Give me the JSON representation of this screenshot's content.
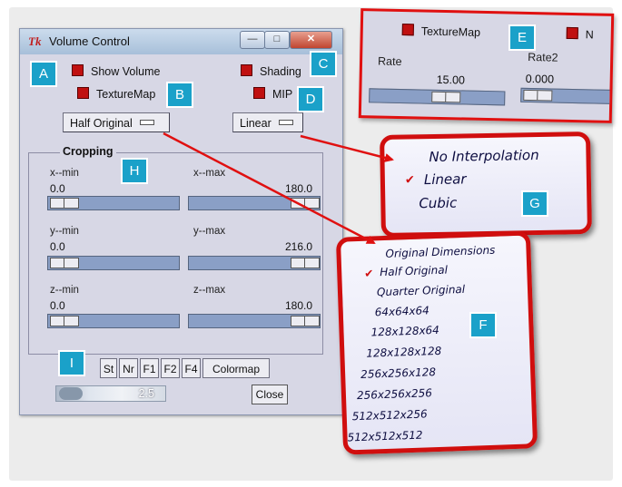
{
  "window": {
    "title": "Volume Control",
    "title_icon": "Tk",
    "buttons": {
      "minimize": "—",
      "maximize": "□",
      "close": "✕"
    }
  },
  "options": {
    "show_volume": "Show Volume",
    "shading": "Shading",
    "texturemap": "TextureMap",
    "mip": "MIP"
  },
  "dropdowns": {
    "size": "Half Original",
    "interpolation": "Linear"
  },
  "cropping": {
    "label": "Cropping",
    "sliders": [
      {
        "label": "x--min",
        "value": "0.0",
        "fraction": 0.0
      },
      {
        "label": "x--max",
        "value": "180.0",
        "fraction": 1.0
      },
      {
        "label": "y--min",
        "value": "0.0",
        "fraction": 0.0
      },
      {
        "label": "y--max",
        "value": "216.0",
        "fraction": 1.0
      },
      {
        "label": "z--min",
        "value": "0.0",
        "fraction": 0.0
      },
      {
        "label": "z--max",
        "value": "180.0",
        "fraction": 1.0
      }
    ]
  },
  "bottom": {
    "buttons": [
      "St",
      "Nr",
      "F1",
      "F2",
      "F4",
      "Colormap"
    ],
    "zoom_value": "2.5",
    "close_label": "Close"
  },
  "panel_e": {
    "texturemap": "TextureMap",
    "second_option": "N",
    "rate_label": "Rate",
    "rate_value": "15.00",
    "rate2_label": "Rate2",
    "rate2_value": "0.000"
  },
  "interpolation_menu": {
    "items": [
      "No Interpolation",
      "Linear",
      "Cubic"
    ],
    "selected": "Linear"
  },
  "dimensions_menu": {
    "items": [
      "Original Dimensions",
      "Half Original",
      "Quarter Original",
      "64x64x64",
      "128x128x64",
      "128x128x128",
      "256x256x128",
      "256x256x256",
      "512x512x256",
      "512x512x512"
    ],
    "selected": "Half Original"
  },
  "callouts": [
    "A",
    "B",
    "C",
    "D",
    "E",
    "F",
    "G",
    "H",
    "I"
  ],
  "colors": {
    "callout_badge": "#1aa1c9",
    "highlight_red": "#e01010",
    "checkbox_red": "#c01010",
    "slider_trough": "#8a9fc6"
  }
}
